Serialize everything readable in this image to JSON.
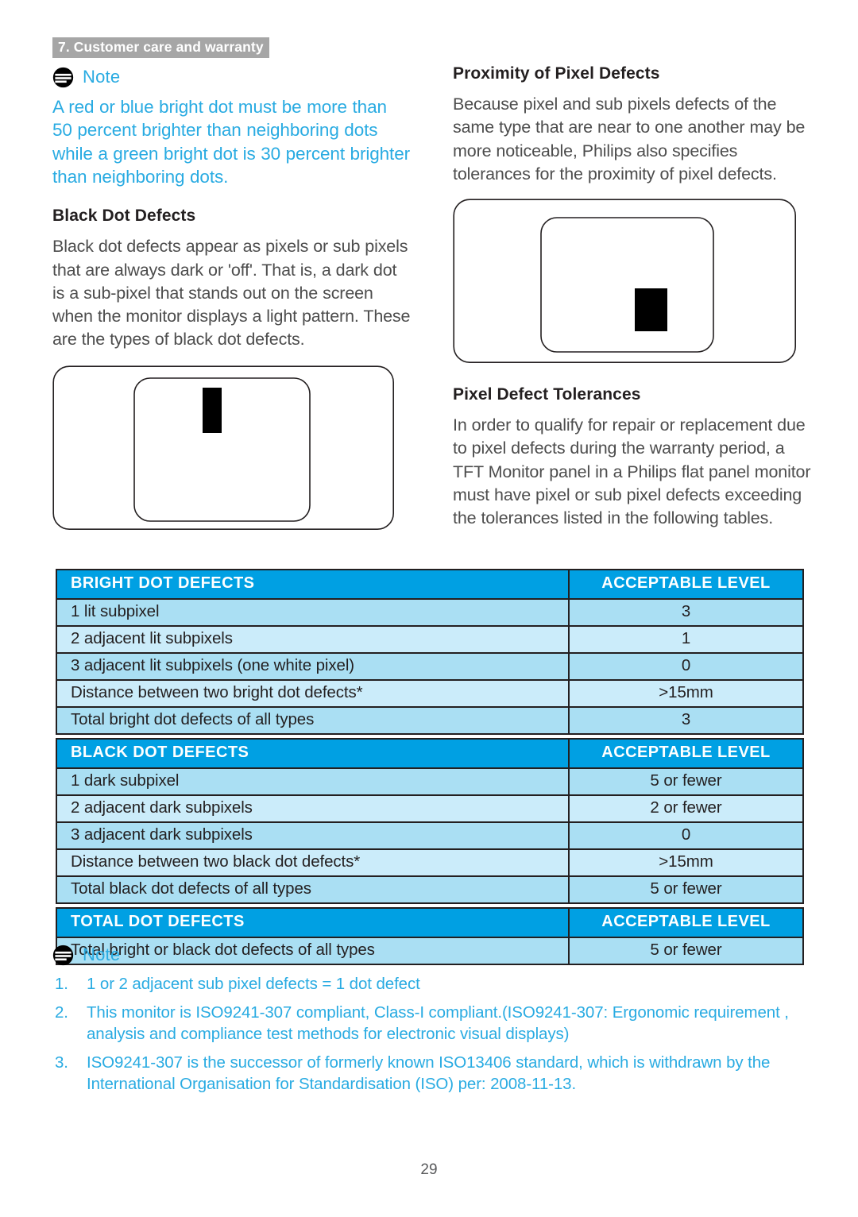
{
  "runhead": "7. Customer care and warranty",
  "colors": {
    "note_blue": "#29abe2",
    "table_header_blue": "#00a0e3",
    "row_odd": "#aadff3",
    "row_even": "#cbecfa",
    "runhead_gray": "#a6a6a6",
    "border": "#231f20"
  },
  "left_column": {
    "note": {
      "icon": "note-icon",
      "label": "Note",
      "text": "A red or blue bright dot must be more than 50 percent brighter than neighboring dots while a green bright dot is 30 percent brighter than neighboring dots."
    },
    "section_heading": "Black Dot Defects",
    "paragraph": "Black dot defects appear as pixels or sub pixels that are always dark or 'off'. That is, a dark dot is a sub-pixel that stands out on the screen when the monitor displays a light pattern. These are the types of black dot defects.",
    "diagram": {
      "name": "black-dot-defect-monitor-diagram",
      "description": "Monitor outline with inner screen and one black vertical sub-pixel defect near the top center"
    }
  },
  "right_column": {
    "section_heading_1": "Proximity of Pixel Defects",
    "paragraph_1": "Because pixel and sub pixels defects of the same type that are near to one another may be more noticeable, Philips also specifies tolerances for the proximity of pixel defects.",
    "diagram": {
      "name": "pixel-defect-proximity-monitor-diagram",
      "description": "Monitor outline with inner screen and one black pixel defect below center"
    },
    "section_heading_2": "Pixel Defect Tolerances",
    "paragraph_2": "In order to qualify for repair or replacement due to pixel defects during the warranty period, a TFT Monitor panel in a Philips flat panel monitor must have pixel or sub pixel defects exceeding the tolerances listed in the following tables."
  },
  "tables": [
    {
      "id": "bright-dot-defects",
      "header": {
        "category": "BRIGHT DOT DEFECTS",
        "level": "ACCEPTABLE LEVEL"
      },
      "rows": [
        {
          "label": "1 lit subpixel",
          "value": "3"
        },
        {
          "label": "2 adjacent lit subpixels",
          "value": "1"
        },
        {
          "label": "3 adjacent lit subpixels (one white pixel)",
          "value": "0"
        },
        {
          "label": "Distance between two bright dot defects*",
          "value": ">15mm"
        },
        {
          "label": "Total bright dot defects of all types",
          "value": "3"
        }
      ]
    },
    {
      "id": "black-dot-defects",
      "header": {
        "category": "BLACK DOT DEFECTS",
        "level": "ACCEPTABLE LEVEL"
      },
      "rows": [
        {
          "label": "1 dark subpixel",
          "value": "5 or fewer"
        },
        {
          "label": "2 adjacent dark subpixels",
          "value": "2 or fewer"
        },
        {
          "label": "3 adjacent dark subpixels",
          "value": "0"
        },
        {
          "label": "Distance between two black dot defects*",
          "value": ">15mm"
        },
        {
          "label": "Total black dot defects of all types",
          "value": "5 or fewer"
        }
      ]
    },
    {
      "id": "total-dot-defects",
      "header": {
        "category": "TOTAL DOT DEFECTS",
        "level": "ACCEPTABLE LEVEL"
      },
      "rows": [
        {
          "label": "Total bright or black dot defects of all types",
          "value": "5 or fewer"
        }
      ]
    }
  ],
  "footer_note": {
    "icon": "note-icon",
    "label": "Note",
    "items": [
      {
        "num": "1.",
        "text": "1 or 2 adjacent sub pixel defects = 1 dot defect"
      },
      {
        "num": "2.",
        "text": "This monitor is ISO9241-307 compliant, Class-I compliant.(ISO9241-307: Ergonomic requirement , analysis and compliance test methods for electronic visual displays)"
      },
      {
        "num": "3.",
        "text": "ISO9241-307 is the successor of formerly known ISO13406 standard, which is withdrawn by the International Organisation for Standardisation (ISO) per: 2008-11-13."
      }
    ]
  },
  "page_number": "29"
}
